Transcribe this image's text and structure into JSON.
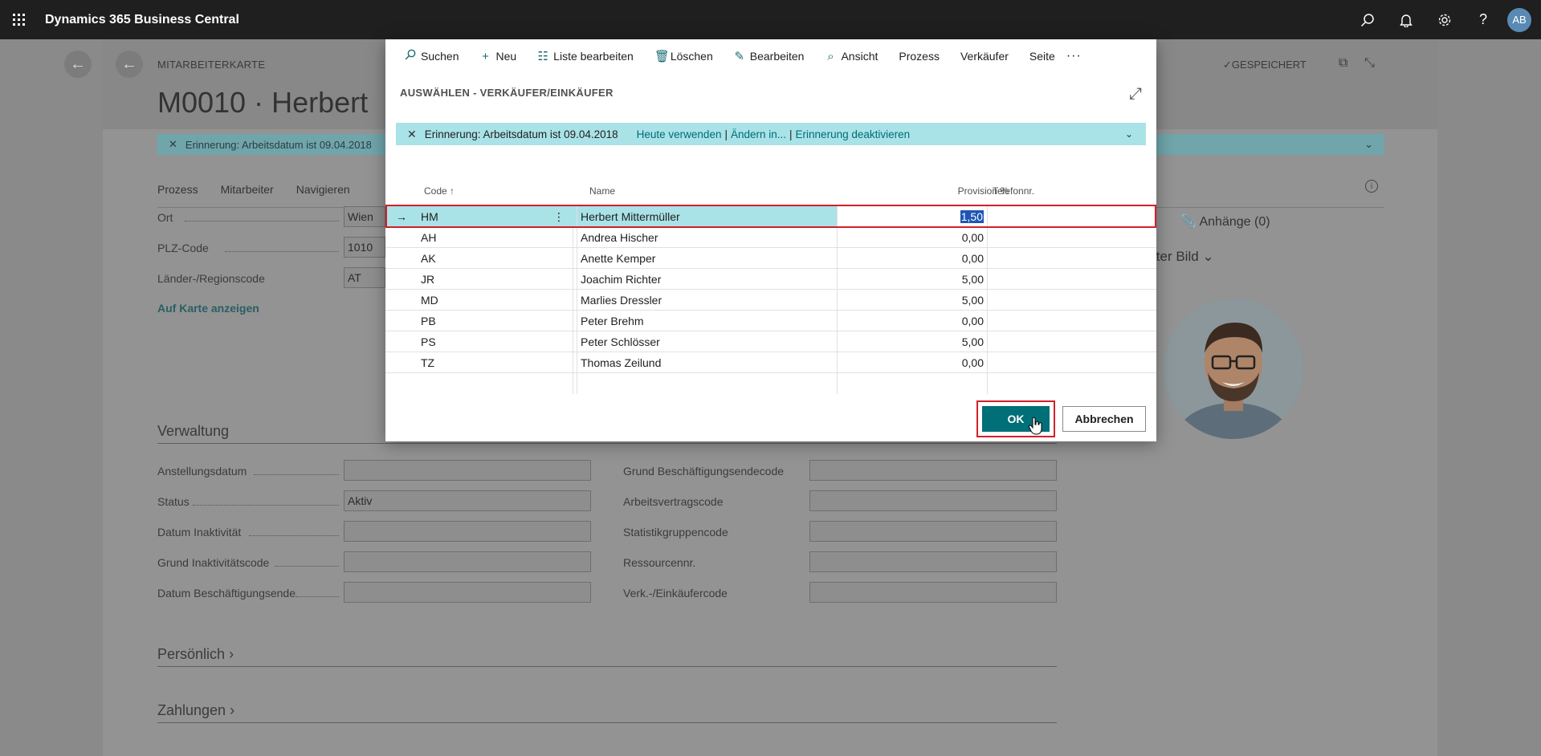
{
  "app": {
    "title": "Dynamics 365 Business Central",
    "avatar": "AB",
    "icons": [
      "waffle-icon",
      "search-icon",
      "bell-icon",
      "gear-icon",
      "help-icon"
    ]
  },
  "background_page": {
    "caption": "MITARBEITERKARTE",
    "title": "M0010 · Herbert",
    "saved_label": "GESPEICHERT",
    "reminder": "Erinnerung: Arbeitsdatum ist 09.04.2018",
    "actions": [
      "Prozess",
      "Mitarbeiter",
      "Navigieren"
    ],
    "address_fields": [
      {
        "label": "Ort",
        "value": "Wien"
      },
      {
        "label": "PLZ-Code",
        "value": "1010"
      },
      {
        "label": "Länder-/Regionscode",
        "value": "AT"
      }
    ],
    "map_link": "Auf Karte anzeigen",
    "attachments": "Anhänge (0)",
    "picture_label": "iter Bild",
    "section_verwaltung": "Verwaltung",
    "left_fields": [
      {
        "label": "Anstellungsdatum",
        "value": ""
      },
      {
        "label": "Status",
        "value": "Aktiv"
      },
      {
        "label": "Datum Inaktivität",
        "value": ""
      },
      {
        "label": "Grund Inaktivitätscode",
        "value": ""
      },
      {
        "label": "Datum Beschäftigungsende",
        "value": ""
      }
    ],
    "right_fields": [
      {
        "label": "Grund Beschäftigungsendecode",
        "value": ""
      },
      {
        "label": "Arbeitsvertragscode",
        "value": ""
      },
      {
        "label": "Statistikgruppencode",
        "value": ""
      },
      {
        "label": "Ressourcennr.",
        "value": ""
      },
      {
        "label": "Verk.-/Einkäufercode",
        "value": ""
      }
    ],
    "section_persoenlich": "Persönlich",
    "section_zahlungen": "Zahlungen"
  },
  "modal": {
    "toolbar": [
      {
        "label": "Suchen",
        "icon": "search-icon"
      },
      {
        "label": "Neu",
        "icon": "plus-icon"
      },
      {
        "label": "Liste bearbeiten",
        "icon": "edit-list-icon"
      },
      {
        "label": "Löschen",
        "icon": "trash-icon"
      },
      {
        "label": "Bearbeiten",
        "icon": "pencil-icon"
      },
      {
        "label": "Ansicht",
        "icon": "view-icon"
      },
      {
        "label": "Prozess",
        "icon": ""
      },
      {
        "label": "Verkäufer",
        "icon": ""
      },
      {
        "label": "Seite",
        "icon": ""
      }
    ],
    "title": "AUSWÄHLEN - VERKÄUFER/EINKÄUFER",
    "reminder": {
      "message": "Erinnerung: Arbeitsdatum ist 09.04.2018",
      "link1": "Heute verwenden",
      "link2": "Ändern in...",
      "link3": "Erinnerung deaktivieren"
    },
    "columns": {
      "code": "Code ↑",
      "name": "Name",
      "provision": "Provision %",
      "tel": "Telefonnr."
    },
    "rows": [
      {
        "code": "HM",
        "name": "Herbert Mittermüller",
        "provision": "1,50",
        "tel": "",
        "selected": true
      },
      {
        "code": "AH",
        "name": "Andrea Hischer",
        "provision": "0,00",
        "tel": ""
      },
      {
        "code": "AK",
        "name": "Anette Kemper",
        "provision": "0,00",
        "tel": ""
      },
      {
        "code": "JR",
        "name": "Joachim Richter",
        "provision": "5,00",
        "tel": ""
      },
      {
        "code": "MD",
        "name": "Marlies Dressler",
        "provision": "5,00",
        "tel": ""
      },
      {
        "code": "PB",
        "name": "Peter Brehm",
        "provision": "0,00",
        "tel": ""
      },
      {
        "code": "PS",
        "name": "Peter Schlösser",
        "provision": "5,00",
        "tel": ""
      },
      {
        "code": "TZ",
        "name": "Thomas Zeilund",
        "provision": "0,00",
        "tel": ""
      }
    ],
    "ok_label": "OK",
    "cancel_label": "Abbrechen"
  }
}
